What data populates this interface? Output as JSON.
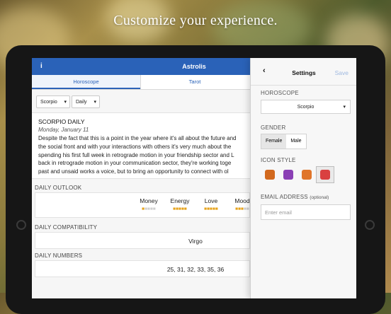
{
  "promo": {
    "headline": "Customize your experience."
  },
  "app": {
    "title": "Astrolis",
    "info_glyph": "i",
    "tabs": [
      {
        "label": "Horoscope",
        "active": true
      },
      {
        "label": "Tarot",
        "active": false
      }
    ]
  },
  "filters": {
    "sign": "Scorpio",
    "period": "Daily"
  },
  "reading": {
    "title": "SCORPIO DAILY",
    "date": "Monday, January 11",
    "lines": [
      "Despite the fact that this is a point in the year where it's all about the future and",
      "the social front and with your interactions with others it's very much about the",
      "spending his first full week in retrograde motion in your friendship sector and L",
      "back in retrograde motion in your communication sector, they're working toge",
      "past and unsaid works a voice, but to bring an opportunity to connect with ol"
    ]
  },
  "daily_outlook": {
    "heading": "DAILY OUTLOOK",
    "items": [
      {
        "label": "Money",
        "rating": 1
      },
      {
        "label": "Energy",
        "rating": 5
      },
      {
        "label": "Love",
        "rating": 5
      },
      {
        "label": "Mood",
        "rating": 3
      }
    ]
  },
  "daily_compatibility": {
    "heading": "DAILY COMPATIBILITY",
    "value": "Virgo"
  },
  "daily_numbers": {
    "heading": "DAILY NUMBERS",
    "value": "25, 31, 32, 33, 35, 36"
  },
  "settings": {
    "back_glyph": "‹",
    "title": "Settings",
    "save_label": "Save",
    "horoscope_label": "HOROSCOPE",
    "horoscope_value": "Scorpio",
    "gender_label": "GENDER",
    "gender_options": [
      "Female",
      "Male"
    ],
    "gender_selected": "Female",
    "icon_style_label": "ICON STYLE",
    "icon_styles": [
      {
        "name": "flame-style-icon",
        "color": "#d2691e"
      },
      {
        "name": "scorpion-purple-icon",
        "color": "#8a3fb5"
      },
      {
        "name": "orange-tile-icon",
        "color": "#e0752a"
      },
      {
        "name": "red-badge-icon",
        "color": "#d94040"
      }
    ],
    "icon_style_selected": 3,
    "email_label": "EMAIL ADDRESS",
    "email_optional": "(optional)",
    "email_placeholder": "Enter email"
  },
  "colors": {
    "brand_blue": "#2a62b8",
    "star_on": "#e6a21a",
    "star_off": "#cfcfcf"
  }
}
